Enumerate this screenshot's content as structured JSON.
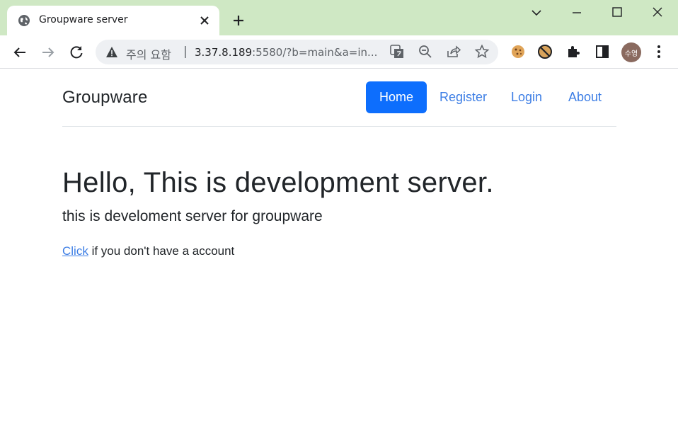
{
  "browser": {
    "tab": {
      "title": "Groupware server"
    },
    "omnibox": {
      "security_label": "주의 요함",
      "separator": "|",
      "host": "3.37.8.189",
      "rest": ":5580/?b=main&a=in..."
    },
    "profile_initials": "수영"
  },
  "page": {
    "brand": "Groupware",
    "nav": {
      "home": "Home",
      "register": "Register",
      "login": "Login",
      "about": "About"
    },
    "hero": {
      "title": "Hello, This is development server.",
      "lead": "this is develoment server for groupware",
      "link_text": "Click",
      "after_link": " if you don't have a account"
    }
  },
  "colors": {
    "tabstrip": "#cfe8c4",
    "primary": "#0d6efd",
    "link": "#3d7ee5"
  }
}
